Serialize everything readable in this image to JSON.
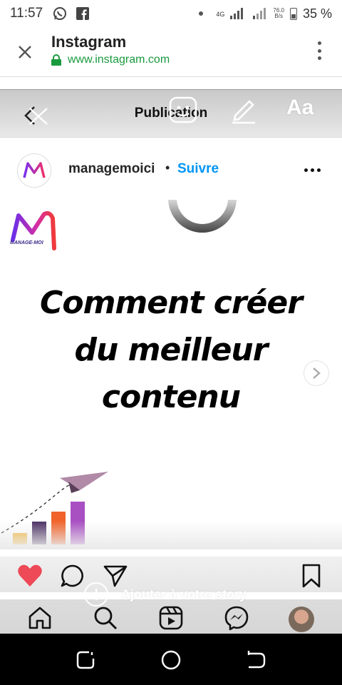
{
  "status_bar": {
    "time": "11:57",
    "network": "4G",
    "speed_value": "76.0",
    "speed_unit": "B/s",
    "battery": "35 %"
  },
  "browser": {
    "title": "Instagram",
    "url": "www.instagram.com",
    "url_color": "#1a9a3f"
  },
  "story_editor": {
    "title": "Publication",
    "text_tool_label": "Aa"
  },
  "post": {
    "username": "managemoici",
    "separator": "•",
    "follow_label": "Suivre",
    "follow_color": "#0095f6",
    "image": {
      "logo_text": "MANAGE-MOI",
      "headline_lines": [
        "Comment créer",
        "du meilleur",
        "contenu"
      ],
      "chart_bar_colors": [
        "#f2b53b",
        "#4a2f63",
        "#f0642c",
        "#a84fc2"
      ]
    }
  },
  "actions": {
    "like_color": "#ed4956",
    "icons": [
      "heart-icon",
      "comment-icon",
      "share-icon",
      "bookmark-icon"
    ]
  },
  "add_to_story": {
    "label": "Ajouter à votre story"
  },
  "bottom_nav": {
    "items": [
      "home-icon",
      "search-icon",
      "reels-icon",
      "messenger-icon",
      "profile-avatar"
    ]
  }
}
